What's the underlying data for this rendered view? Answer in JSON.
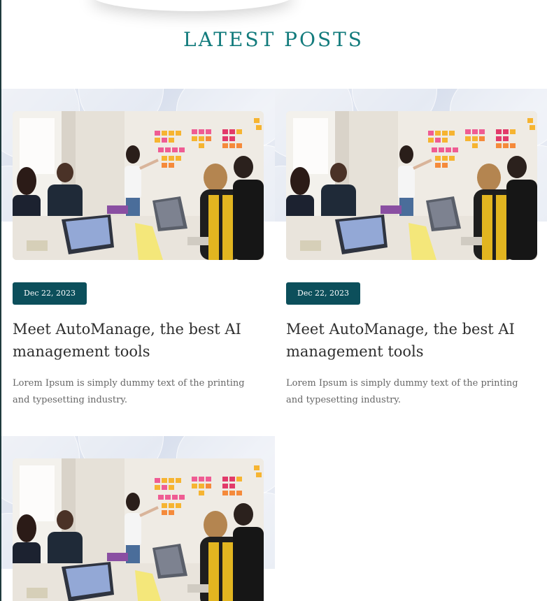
{
  "section": {
    "title": "LATEST POSTS"
  },
  "posts": [
    {
      "date": "Dec 22, 2023",
      "title": "Meet AutoManage, the best AI management tools",
      "excerpt": "Lorem Ipsum is simply dummy text of the printing and typesetting industry."
    },
    {
      "date": "Dec 22, 2023",
      "title": "Meet AutoManage, the best AI management tools",
      "excerpt": "Lorem Ipsum is simply dummy text of the printing and typesetting industry."
    },
    {
      "date": "",
      "title": "",
      "excerpt": ""
    }
  ],
  "colors": {
    "title": "#127b7c",
    "badge": "#0c4f5b"
  }
}
